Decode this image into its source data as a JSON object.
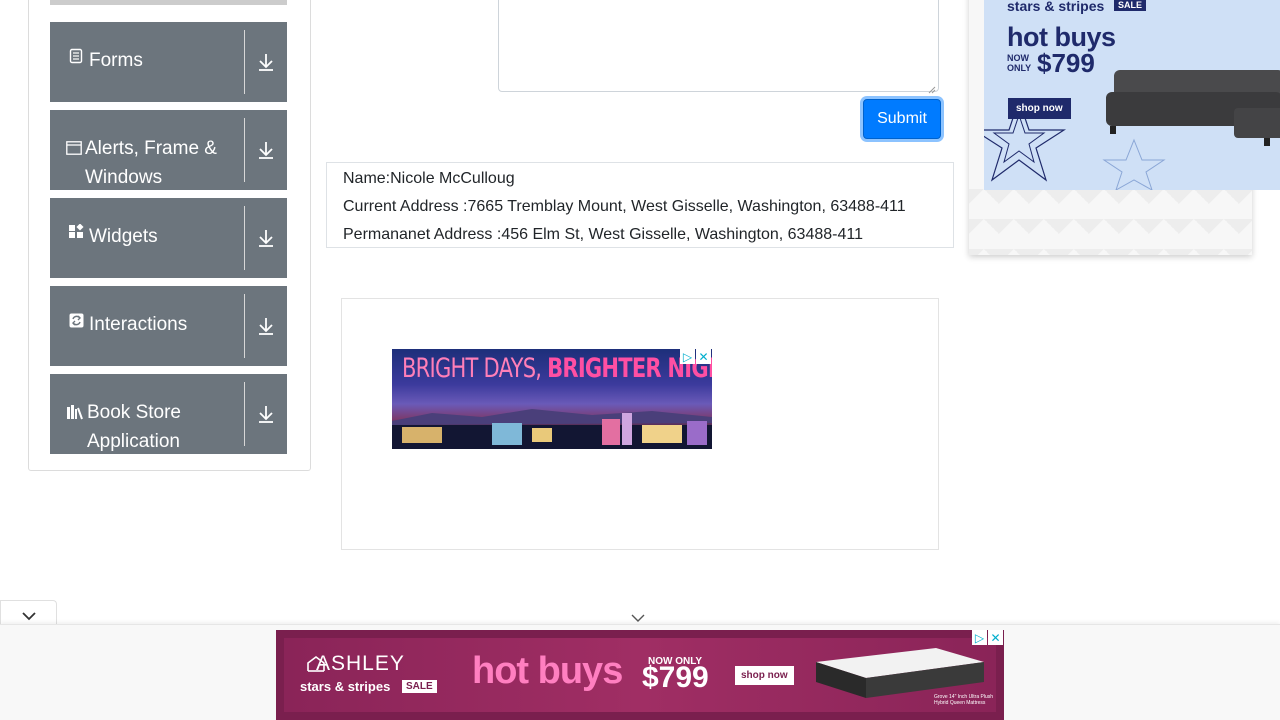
{
  "sidebar": {
    "groups": [
      {
        "label": "Forms",
        "icon": "form-icon"
      },
      {
        "label": "Alerts, Frame & Windows",
        "icon": "window-icon"
      },
      {
        "label": "Widgets",
        "icon": "widgets-icon"
      },
      {
        "label": "Interactions",
        "icon": "interactions-icon"
      },
      {
        "label": "Book Store Application",
        "icon": "books-icon"
      }
    ]
  },
  "form": {
    "submit_label": "Submit"
  },
  "output": {
    "name": "Name:Nicole McCulloug",
    "current_address": "Current Address :7665 Tremblay Mount, West Gisselle, Washington, 63488-411",
    "permanent_address": "Permananet Address :456 Elm St, West Gisselle, Washington, 63488-411"
  },
  "ads": {
    "vegas": {
      "headline_part1": "BRIGHT DAYS, ",
      "headline_part2": "BRIGHTER NIGHTS"
    },
    "side": {
      "brand": "stars & stripes",
      "sale": "SALE",
      "headline": "hot buys",
      "now_only": "NOW ONLY",
      "price": "$799",
      "cta": "shop now"
    },
    "bottom": {
      "brand": "ASHLEY",
      "subbrand": "stars & stripes",
      "sale": "SALE",
      "headline": "hot buys",
      "now_only": "NOW ONLY",
      "price": "$799",
      "cta": "shop now",
      "fine_print": "Grove 14\" Inch Ultra Plush Hybrid Queen Mattress"
    }
  },
  "colors": {
    "primary": "#007bff",
    "sidebar_group": "#6c757d",
    "ad_navy": "#1f2a6b",
    "ad_magenta": "#7a1f4e"
  }
}
